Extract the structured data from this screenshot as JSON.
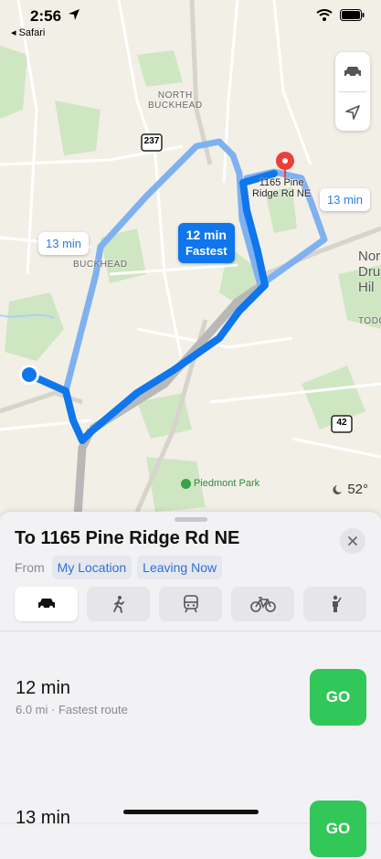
{
  "status_bar": {
    "time": "2:56",
    "back_app": "◂ Safari"
  },
  "map": {
    "labels": {
      "north_buckhead": "NORTH\nBUCKHEAD",
      "buckhead": "BUCKHEAD",
      "piedmont_park": "Piedmont Park",
      "north_druid_hills": "Nor\nDru\nHil",
      "todo": "TODO"
    },
    "highway_shields": [
      "237",
      "42"
    ],
    "destination_label": "1165 Pine\nRidge Rd NE",
    "route_chips": {
      "left": "13 min",
      "right": "13 min",
      "best_time": "12 min",
      "best_tag": "Fastest"
    },
    "weather": {
      "temperature": "52°",
      "icon": "moon-cloud-icon"
    }
  },
  "sheet": {
    "title": "To 1165 Pine Ridge Rd NE",
    "from_label": "From",
    "origin": "My Location",
    "departure": "Leaving Now",
    "modes": [
      "car-icon",
      "walk-icon",
      "transit-icon",
      "bike-icon",
      "rideshare-icon"
    ],
    "active_mode": "car-icon",
    "routes": [
      {
        "time": "12 min",
        "detail": "6.0 mi · Fastest route",
        "go": "GO"
      },
      {
        "time": "13 min",
        "detail": "",
        "go": "GO"
      }
    ]
  },
  "colors": {
    "route_primary": "#0f76ec",
    "route_alt": "#7fb1f0",
    "go_green": "#32c759",
    "pin_red": "#ef3e3a"
  }
}
